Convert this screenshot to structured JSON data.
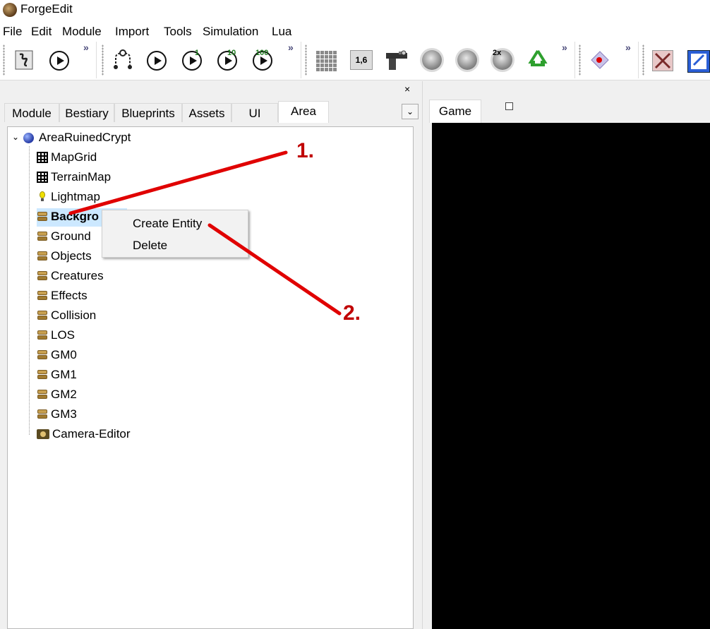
{
  "window": {
    "title": "ForgeEdit"
  },
  "menu": [
    "File",
    "Edit",
    "Module",
    "Import",
    "Tools",
    "Simulation",
    "Lua"
  ],
  "toolbar": {
    "overflow": "»",
    "play_counts": [
      "1",
      "10",
      "100"
    ],
    "coord_label": "1,6",
    "speed_label": "2x"
  },
  "left_pane": {
    "close": "×",
    "tabs": [
      "Module",
      "Bestiary",
      "Blueprints",
      "Assets",
      "UI",
      "Area"
    ],
    "active_tab": "Area",
    "dropdown": "⌄"
  },
  "tree": {
    "root": "AreaRuinedCrypt",
    "items": [
      "MapGrid",
      "TerrainMap",
      "Lightmap",
      "Backgro",
      "Ground",
      "Objects",
      "Creatures",
      "Effects",
      "Collision",
      "LOS",
      "GM0",
      "GM1",
      "GM2",
      "GM3",
      "Camera-Editor"
    ],
    "selected_index": 3
  },
  "context_menu": {
    "items": [
      "Create Entity",
      "Delete"
    ]
  },
  "right_pane": {
    "tab": "Game"
  },
  "annotations": {
    "label_1": "1.",
    "label_2": "2.",
    "color": "#e00000"
  }
}
